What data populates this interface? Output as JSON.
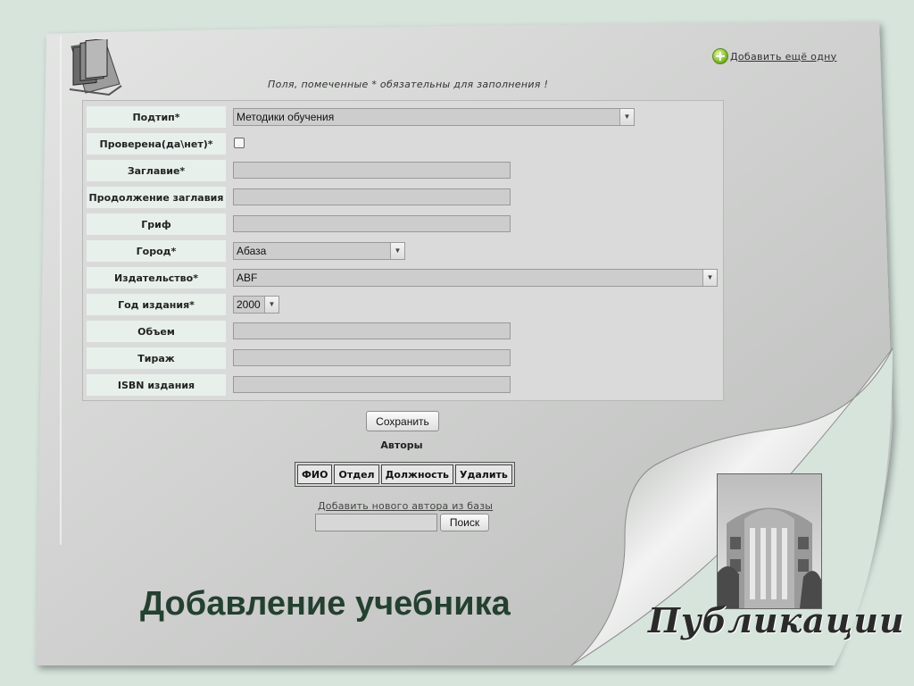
{
  "header": {
    "add_more_label": "Добавить ещё одну",
    "required_note": "Поля, помеченные * обязательны для заполнения !"
  },
  "form": {
    "subtype": {
      "label": "Подтип*",
      "value": "Методики обучения"
    },
    "verified": {
      "label": "Проверена(да\\нет)*",
      "checked": false
    },
    "title": {
      "label": "Заглавие*",
      "value": ""
    },
    "title_continuation": {
      "label": "Продолжение заглавия",
      "value": ""
    },
    "stamp": {
      "label": "Гриф",
      "value": ""
    },
    "city": {
      "label": "Город*",
      "value": "Абаза"
    },
    "publisher": {
      "label": "Издательство*",
      "value": "ABF"
    },
    "year": {
      "label": "Год издания*",
      "value": "2000"
    },
    "volume": {
      "label": "Объем",
      "value": ""
    },
    "circulation": {
      "label": "Тираж",
      "value": ""
    },
    "isbn": {
      "label": "ISBN издания",
      "value": ""
    }
  },
  "save_label": "Сохранить",
  "authors": {
    "title": "Авторы",
    "columns": [
      "ФИО",
      "Отдел",
      "Должность",
      "Удалить"
    ],
    "add_from_db_label": "Добавить нового автора из базы",
    "search_value": "",
    "search_label": "Поиск"
  },
  "page_title": "Добавление учебника",
  "brand": "Публикации",
  "colors": {
    "background": "#d6e4dc",
    "sheet": "#cfd1cf",
    "title": "#244030",
    "label_cell": "#e8f0ec"
  }
}
